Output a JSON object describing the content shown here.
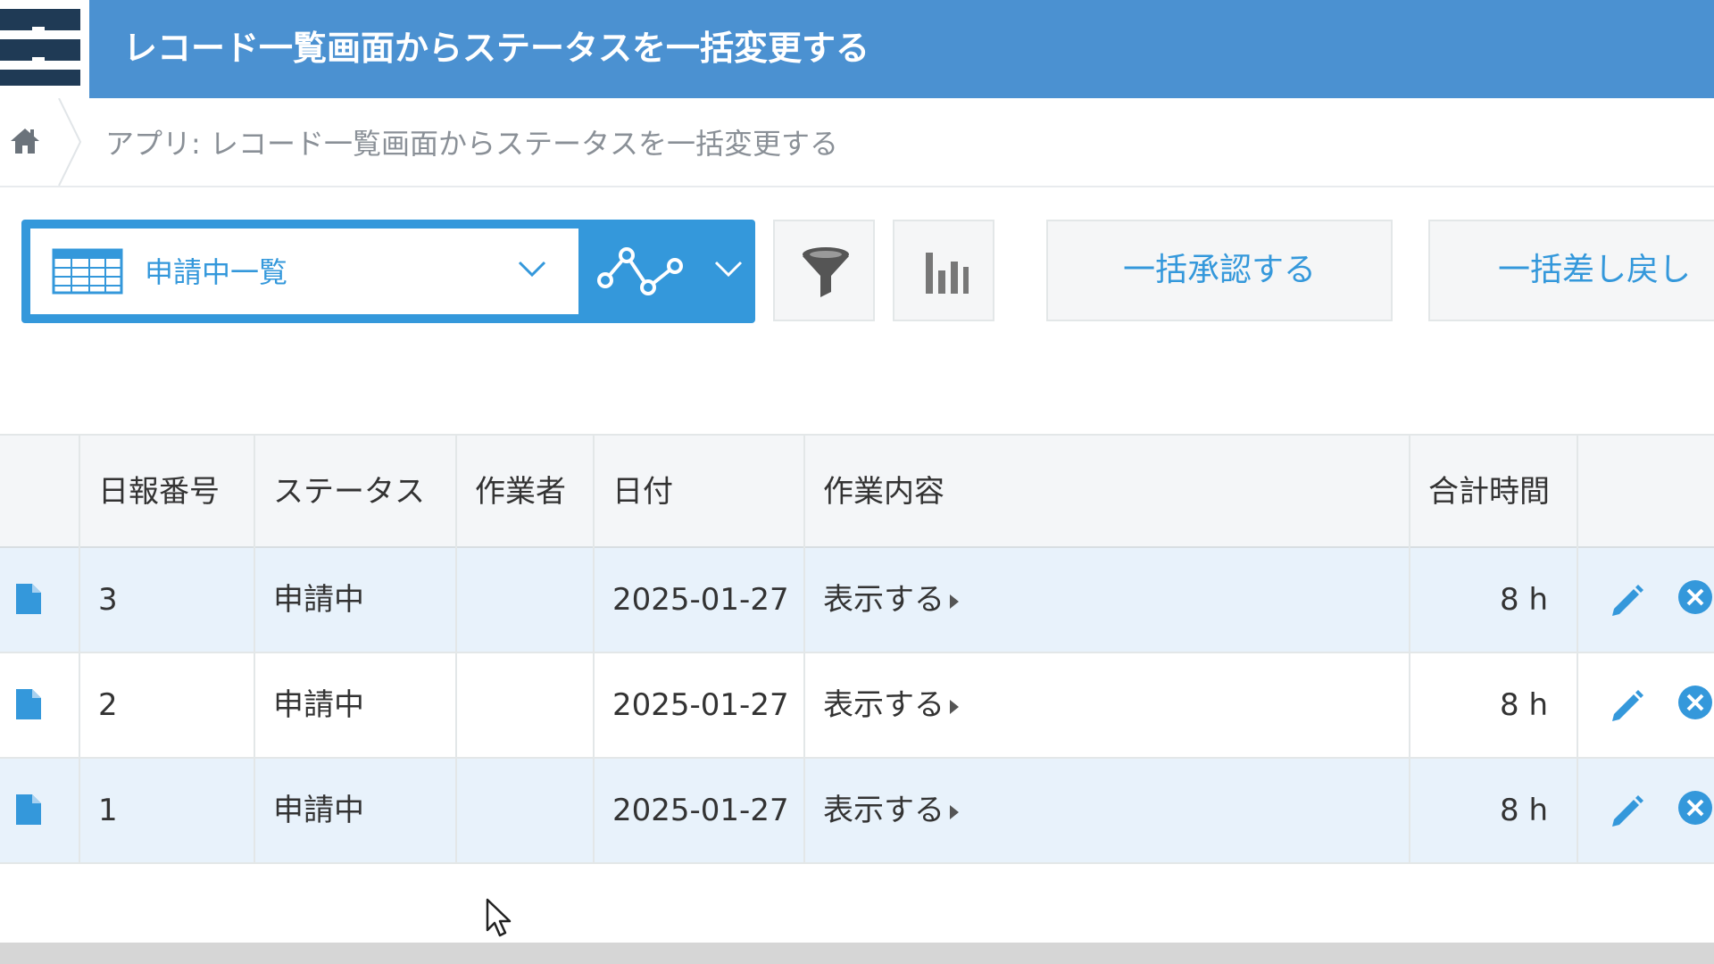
{
  "header": {
    "title": "レコード一覧画面からステータスを一括変更する"
  },
  "breadcrumb": {
    "app_label": "アプリ: レコード一覧画面からステータスを一括変更する"
  },
  "toolbar": {
    "view_name": "申請中一覧",
    "bulk_approve_label": "一括承認する",
    "bulk_return_label": "一括差し戻し"
  },
  "table": {
    "headers": [
      "日報番号",
      "ステータス",
      "作業者",
      "日付",
      "作業内容",
      "合計時間"
    ],
    "rows": [
      {
        "number": "3",
        "status": "申請中",
        "worker": "",
        "date": "2025-01-27",
        "content_link": "表示する",
        "total_time": "8 h"
      },
      {
        "number": "2",
        "status": "申請中",
        "worker": "",
        "date": "2025-01-27",
        "content_link": "表示する",
        "total_time": "8 h"
      },
      {
        "number": "1",
        "status": "申請中",
        "worker": "",
        "date": "2025-01-27",
        "content_link": "表示する",
        "total_time": "8 h"
      }
    ]
  },
  "colors": {
    "header_bg": "#4b91d1",
    "accent": "#3498db",
    "row_highlight": "#e8f2fb"
  },
  "icons": {
    "app": "app-icon",
    "home": "home-icon",
    "view": "table-grid-icon",
    "graph": "line-graph-icon",
    "filter": "filter-funnel-icon",
    "chart": "bar-chart-icon",
    "detail": "document-icon",
    "edit": "pencil-icon",
    "delete": "close-circle-icon"
  }
}
